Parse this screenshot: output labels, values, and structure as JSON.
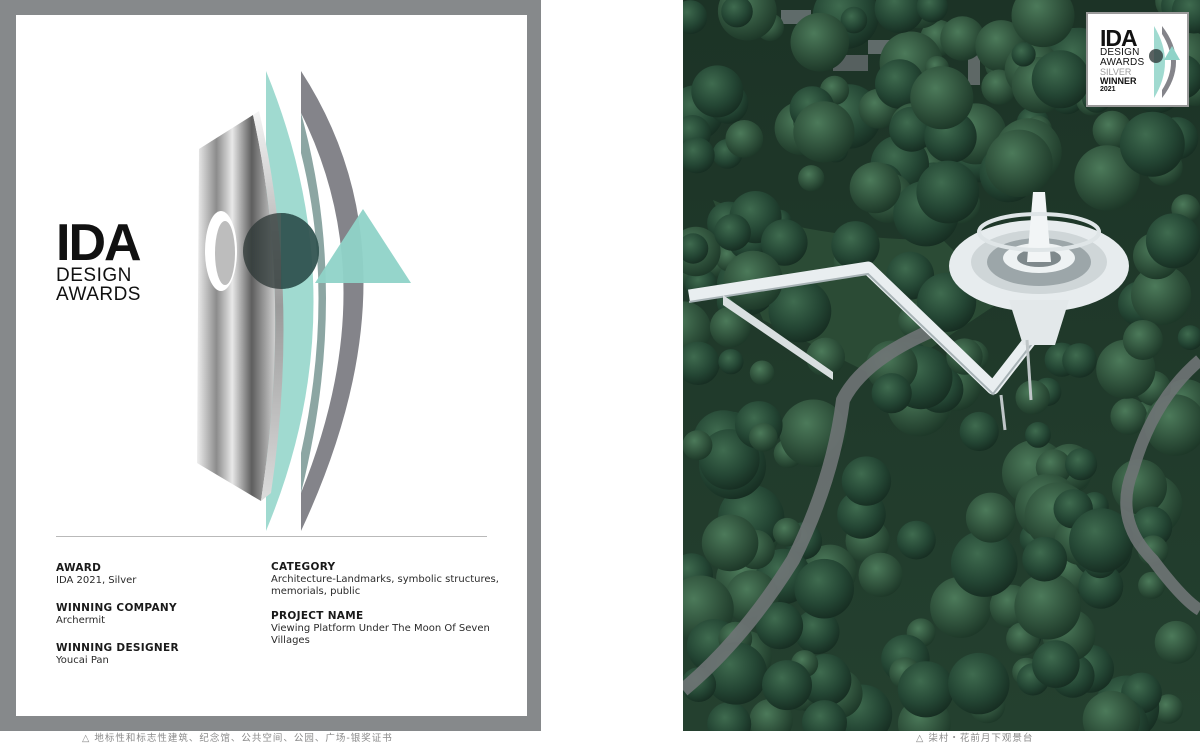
{
  "logo": {
    "ida": "IDA",
    "line1": "DESIGN",
    "line2": "AWARDS"
  },
  "award": {
    "label": "AWARD",
    "value": "IDA 2021, Silver"
  },
  "company": {
    "label": "WINNING COMPANY",
    "value": "Archermit"
  },
  "designer": {
    "label": "WINNING DESIGNER",
    "value": "Youcai Pan"
  },
  "category": {
    "label": "CATEGORY",
    "value": "Architecture-Landmarks, symbolic structures, memorials, public"
  },
  "project": {
    "label": "PROJECT NAME",
    "value": "Viewing Platform Under The Moon Of Seven Villages"
  },
  "badge": {
    "ida": "IDA",
    "line1": "DESIGN",
    "line2": "AWARDS",
    "silver": "SILVER",
    "winner": "WINNER",
    "year": "2021"
  },
  "captions": {
    "left": "△ 地标性和标志性建筑、纪念馆、公共空间、公园、广场-银奖证书",
    "right": "△ 柒村・花前月下观景台"
  },
  "colors": {
    "frame": "#86898b",
    "teal": "#8fd3c8",
    "grey_arc": "#6e6e76"
  }
}
